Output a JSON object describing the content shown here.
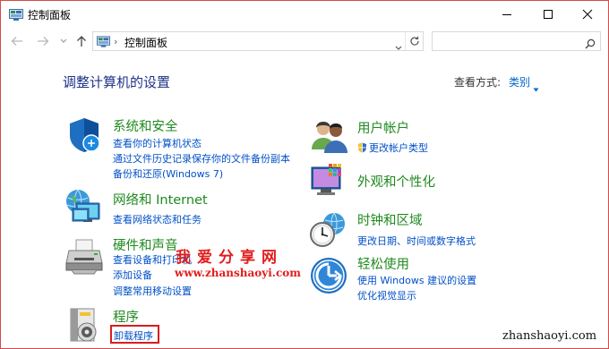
{
  "window": {
    "title": "控制面板"
  },
  "address": {
    "separator": "›",
    "crumb": "控制面板"
  },
  "search": {
    "placeholder": ""
  },
  "header": {
    "title": "调整计算机的设置",
    "viewby_label": "查看方式:",
    "viewby_value": "类别"
  },
  "categories": {
    "security": {
      "title": "系统和安全",
      "links": [
        "查看你的计算机状态",
        "通过文件历史记录保存你的文件备份副本",
        "备份和还原(Windows 7)"
      ]
    },
    "network": {
      "title": "网络和 Internet",
      "links": [
        "查看网络状态和任务"
      ]
    },
    "hardware": {
      "title": "硬件和声音",
      "links": [
        "查看设备和打印机",
        "添加设备",
        "调整常用移动设置"
      ]
    },
    "programs": {
      "title": "程序",
      "links": [
        "卸载程序"
      ]
    },
    "users": {
      "title": "用户帐户",
      "links": [
        "更改帐户类型"
      ]
    },
    "appearance": {
      "title": "外观和个性化",
      "links": []
    },
    "clock": {
      "title": "时钟和区域",
      "links": [
        "更改日期、时间或数字格式"
      ]
    },
    "ease": {
      "title": "轻松使用",
      "links": [
        "使用 Windows 建议的设置",
        "优化视觉显示"
      ]
    }
  },
  "watermark": {
    "cn": "我爱分享网",
    "url": "www.zhanshaoyi.com",
    "corner": "zhanshaoyi.com"
  },
  "colors": {
    "category_title": "#1f8a1f",
    "link": "#0050c8",
    "page_title": "#1e3287",
    "highlight_box": "#d81e1e"
  }
}
